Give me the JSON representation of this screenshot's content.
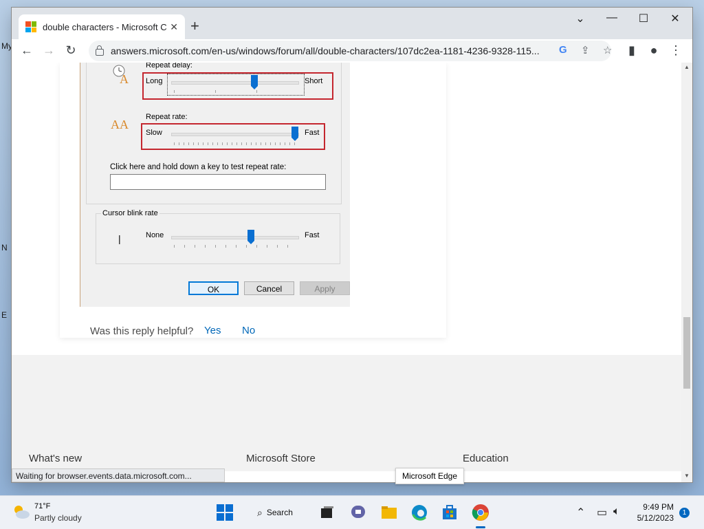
{
  "desktop": {
    "edge_labels": [
      "My",
      "N",
      "E"
    ]
  },
  "browser": {
    "tab_title": "double characters - Microsoft Co",
    "tab_close": "✕",
    "new_tab": "+",
    "window_controls": {
      "chevron": "⌄",
      "minimize": "—",
      "maximize": "☐",
      "close": "✕"
    },
    "url": "answers.microsoft.com/en-us/windows/forum/all/double-characters/107dc2ea-1181-4236-9328-115...",
    "nav": {
      "back": "←",
      "forward": "→",
      "reload": "↻"
    },
    "status_text": "Waiting for browser.events.data.microsoft.com...",
    "tooltip": "Microsoft Edge"
  },
  "dialog": {
    "repeat_delay_label": "Repeat delay:",
    "repeat_delay_min": "Long",
    "repeat_delay_max": "Short",
    "repeat_delay_level": 0.66,
    "repeat_rate_label": "Repeat rate:",
    "repeat_rate_min": "Slow",
    "repeat_rate_max": "Fast",
    "repeat_rate_level": 0.98,
    "test_label": "Click here and hold down a key to test repeat rate:",
    "cursor_group_label": "Cursor blink rate",
    "cursor_min": "None",
    "cursor_max": "Fast",
    "cursor_level": 0.63,
    "cursor_glyph": "|",
    "ok": "OK",
    "cancel": "Cancel",
    "apply": "Apply"
  },
  "feedback": {
    "question": "Was this reply helpful?",
    "yes": "Yes",
    "no": "No"
  },
  "footer": {
    "headings": [
      "What's new",
      "Microsoft Store",
      "Education"
    ]
  },
  "taskbar": {
    "temperature": "71°F",
    "weather": "Partly cloudy",
    "search_label": "Search",
    "time": "9:49 PM",
    "date": "5/12/2023",
    "notification_count": "1"
  },
  "colors": {
    "accent": "#0067b8",
    "highlight_box": "#c4262e",
    "slider_thumb": "#0a6fd1"
  }
}
